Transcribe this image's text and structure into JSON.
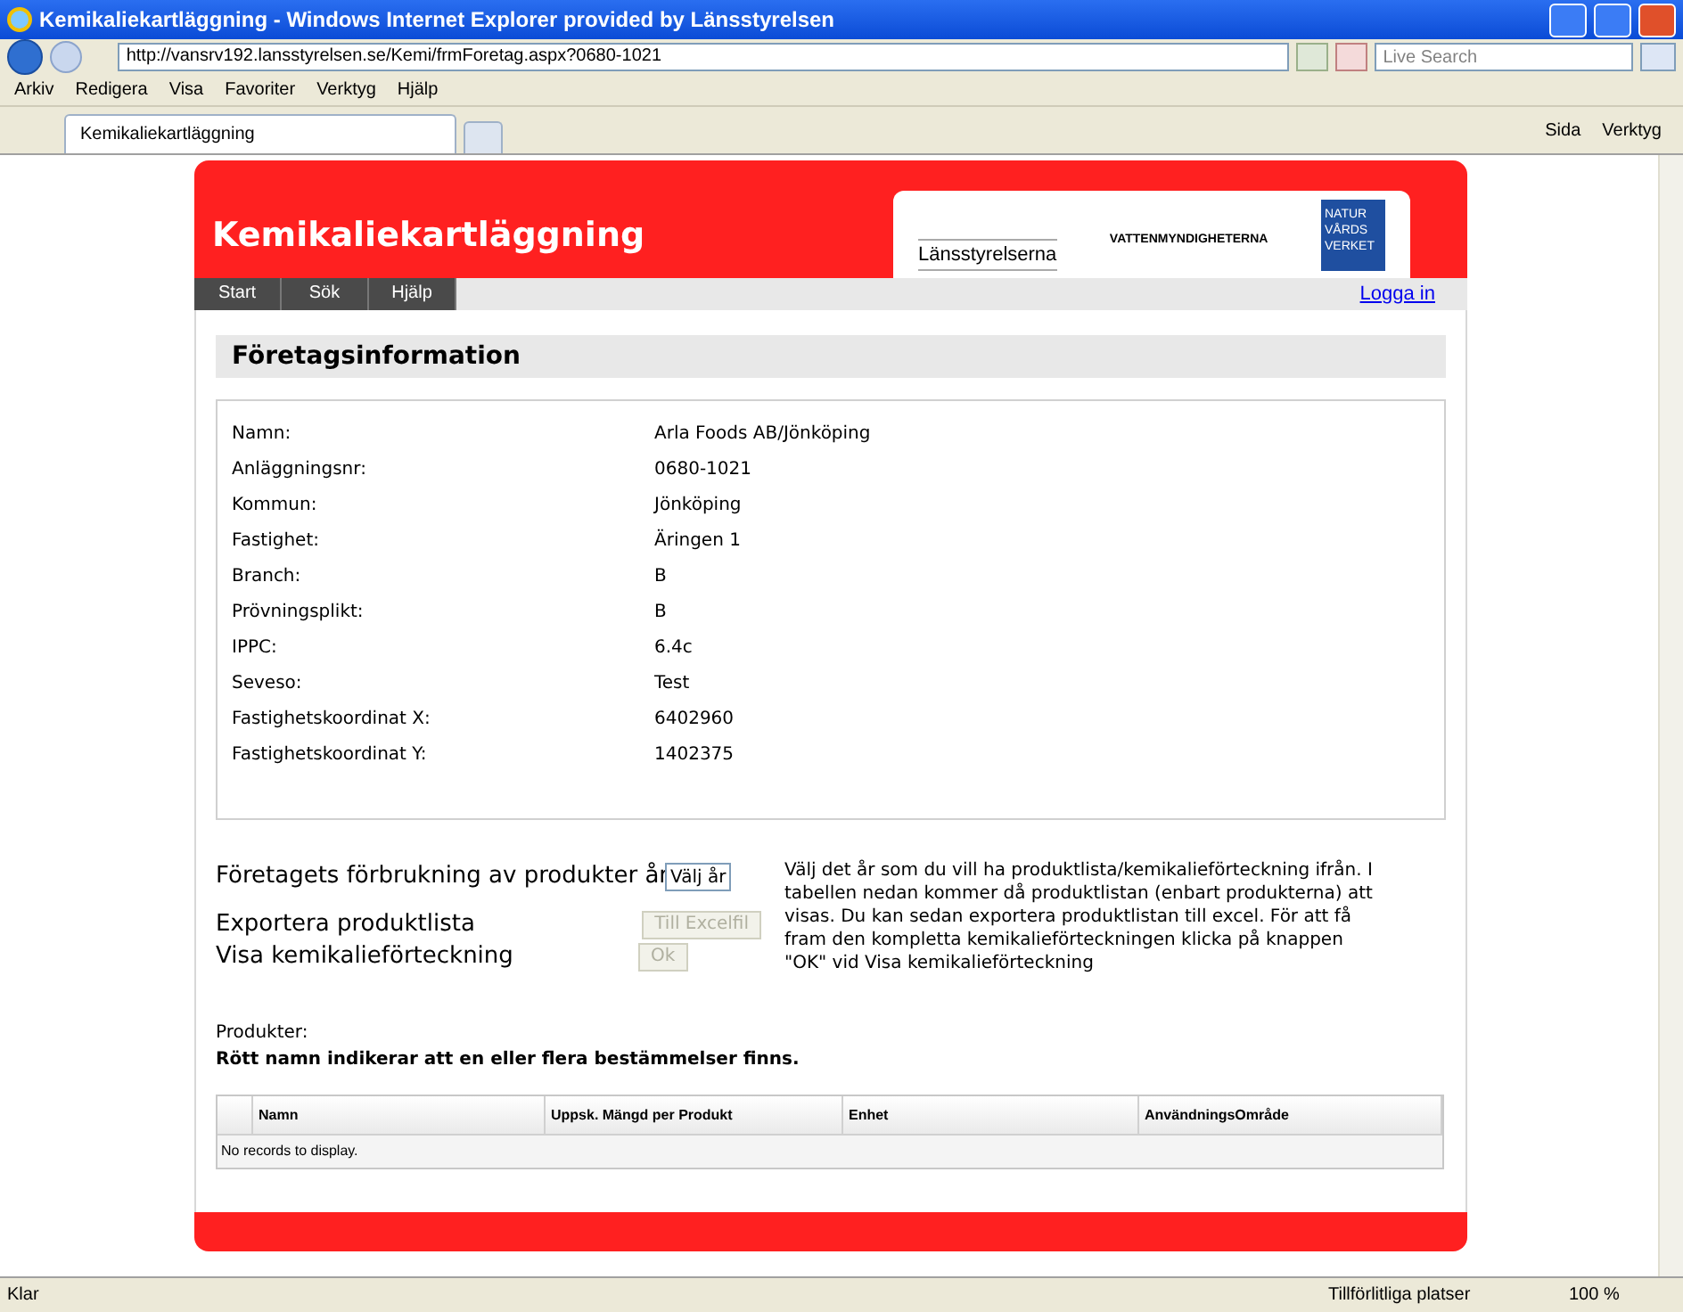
{
  "window": {
    "title": "Kemikaliekartläggning - Windows Internet Explorer provided by Länsstyrelsen"
  },
  "address_bar": {
    "url": "http://vansrv192.lansstyrelsen.se/Kemi/frmForetag.aspx?0680-1021",
    "search_placeholder": "Live Search"
  },
  "menu": [
    "Arkiv",
    "Redigera",
    "Visa",
    "Favoriter",
    "Verktyg",
    "Hjälp"
  ],
  "browser_tabs": [
    {
      "label": "Kemikaliekartläggning",
      "selected": true
    }
  ],
  "toolbar": [
    "Sida",
    "Verktyg"
  ],
  "site": {
    "title": "Kemikaliekartläggning",
    "logos": [
      "Länsstyrelserna",
      "VATTENMYNDIGHETERNA",
      "NATUR VÅRDS VERKET"
    ],
    "nav": [
      {
        "label": "Start"
      },
      {
        "label": "Sök"
      },
      {
        "label": "Hjälp"
      }
    ],
    "login": "Logga in"
  },
  "section_title": "Företagsinformation",
  "info": [
    {
      "label": "Namn:",
      "value": "Arla Foods AB/Jönköping"
    },
    {
      "label": "Anläggningsnr:",
      "value": "0680-1021"
    },
    {
      "label": "Kommun:",
      "value": "Jönköping"
    },
    {
      "label": "Fastighet:",
      "value": "Äringen 1"
    },
    {
      "label": "Branch:",
      "value": "B"
    },
    {
      "label": "Prövningsplikt:",
      "value": "B"
    },
    {
      "label": "IPPC:",
      "value": "6.4c"
    },
    {
      "label": "Seveso:",
      "value": "Test"
    },
    {
      "label": "Fastighetskoordinat X:",
      "value": "6402960"
    },
    {
      "label": "Fastighetskoordinat Y:",
      "value": "1402375"
    }
  ],
  "usage": {
    "label": "Företagets förbrukning av produkter år",
    "year_select": "Välj år",
    "export_label": "Exportera produktlista",
    "export_button": {
      "label": "Till Excelfil",
      "disabled": true
    },
    "show_label": "Visa kemikalieförteckning",
    "ok_button": {
      "label": "Ok",
      "disabled": true
    },
    "help": "Välj det år som du vill ha produktlista/kemikalieförteckning ifrån. I tabellen nedan kommer då produktlistan (enbart produkterna) att visas. Du kan sedan exportera produktlistan till excel. För att få fram den kompletta kemikalieförteckningen klicka på knappen \"OK\" vid Visa kemikalieförteckning"
  },
  "products": {
    "label": "Produkter:",
    "note": "Rött namn indikerar att en eller flera bestämmelser finns.",
    "columns": [
      "Namn",
      "Uppsk. Mängd per Produkt",
      "Enhet",
      "AnvändningsOmråde"
    ],
    "empty": "No records to display."
  },
  "status_bar": {
    "text": "Klar",
    "zone": "Tillförlitliga platser",
    "zoom": "100 %"
  }
}
